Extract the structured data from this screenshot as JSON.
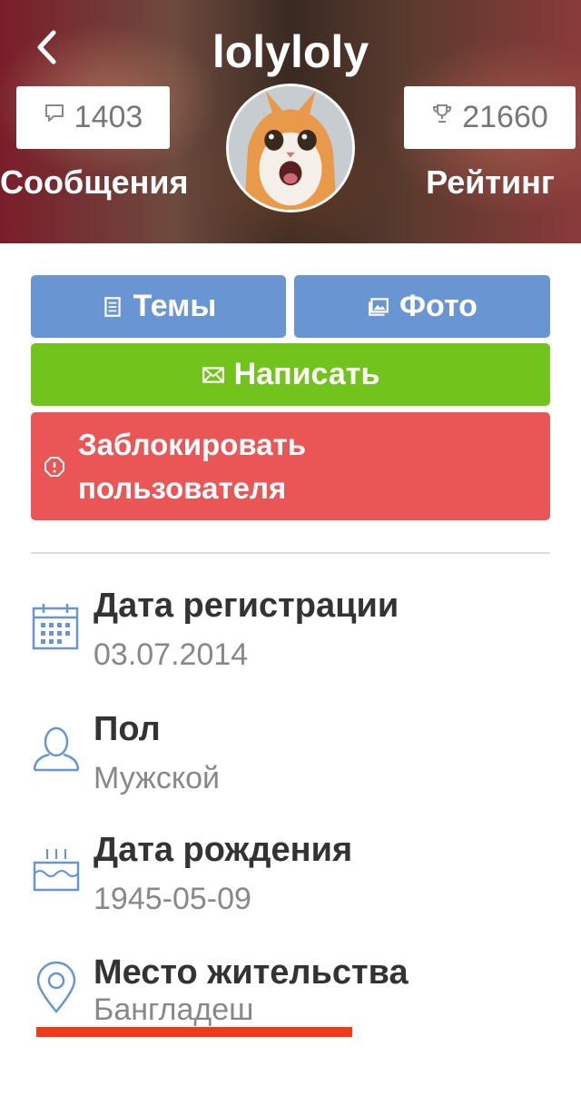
{
  "header": {
    "username": "lolyloly",
    "messages_count": "1403",
    "messages_label": "Сообщения",
    "rating_count": "21660",
    "rating_label": "Рейтинг"
  },
  "actions": {
    "topics_label": "Темы",
    "photo_label": "Фото",
    "write_label": "Написать",
    "block_label_line1": "Заблокировать",
    "block_label_line2": "пользователя"
  },
  "info": [
    {
      "title": "Дата регистрации",
      "value": "03.07.2014",
      "icon": "calendar-icon"
    },
    {
      "title": "Пол",
      "value": "Мужской",
      "icon": "user-icon"
    },
    {
      "title": "Дата рождения",
      "value": "1945-05-09",
      "icon": "birthday-cake-icon"
    },
    {
      "title": "Место жительства",
      "value": "Бангладеш",
      "icon": "location-pin-icon"
    }
  ],
  "colors": {
    "blue_button": "#6a95d3",
    "green_button": "#72c31b",
    "red_button": "#ea5556",
    "icon_blue": "#6a95d3",
    "underline_red": "#f3391a"
  }
}
